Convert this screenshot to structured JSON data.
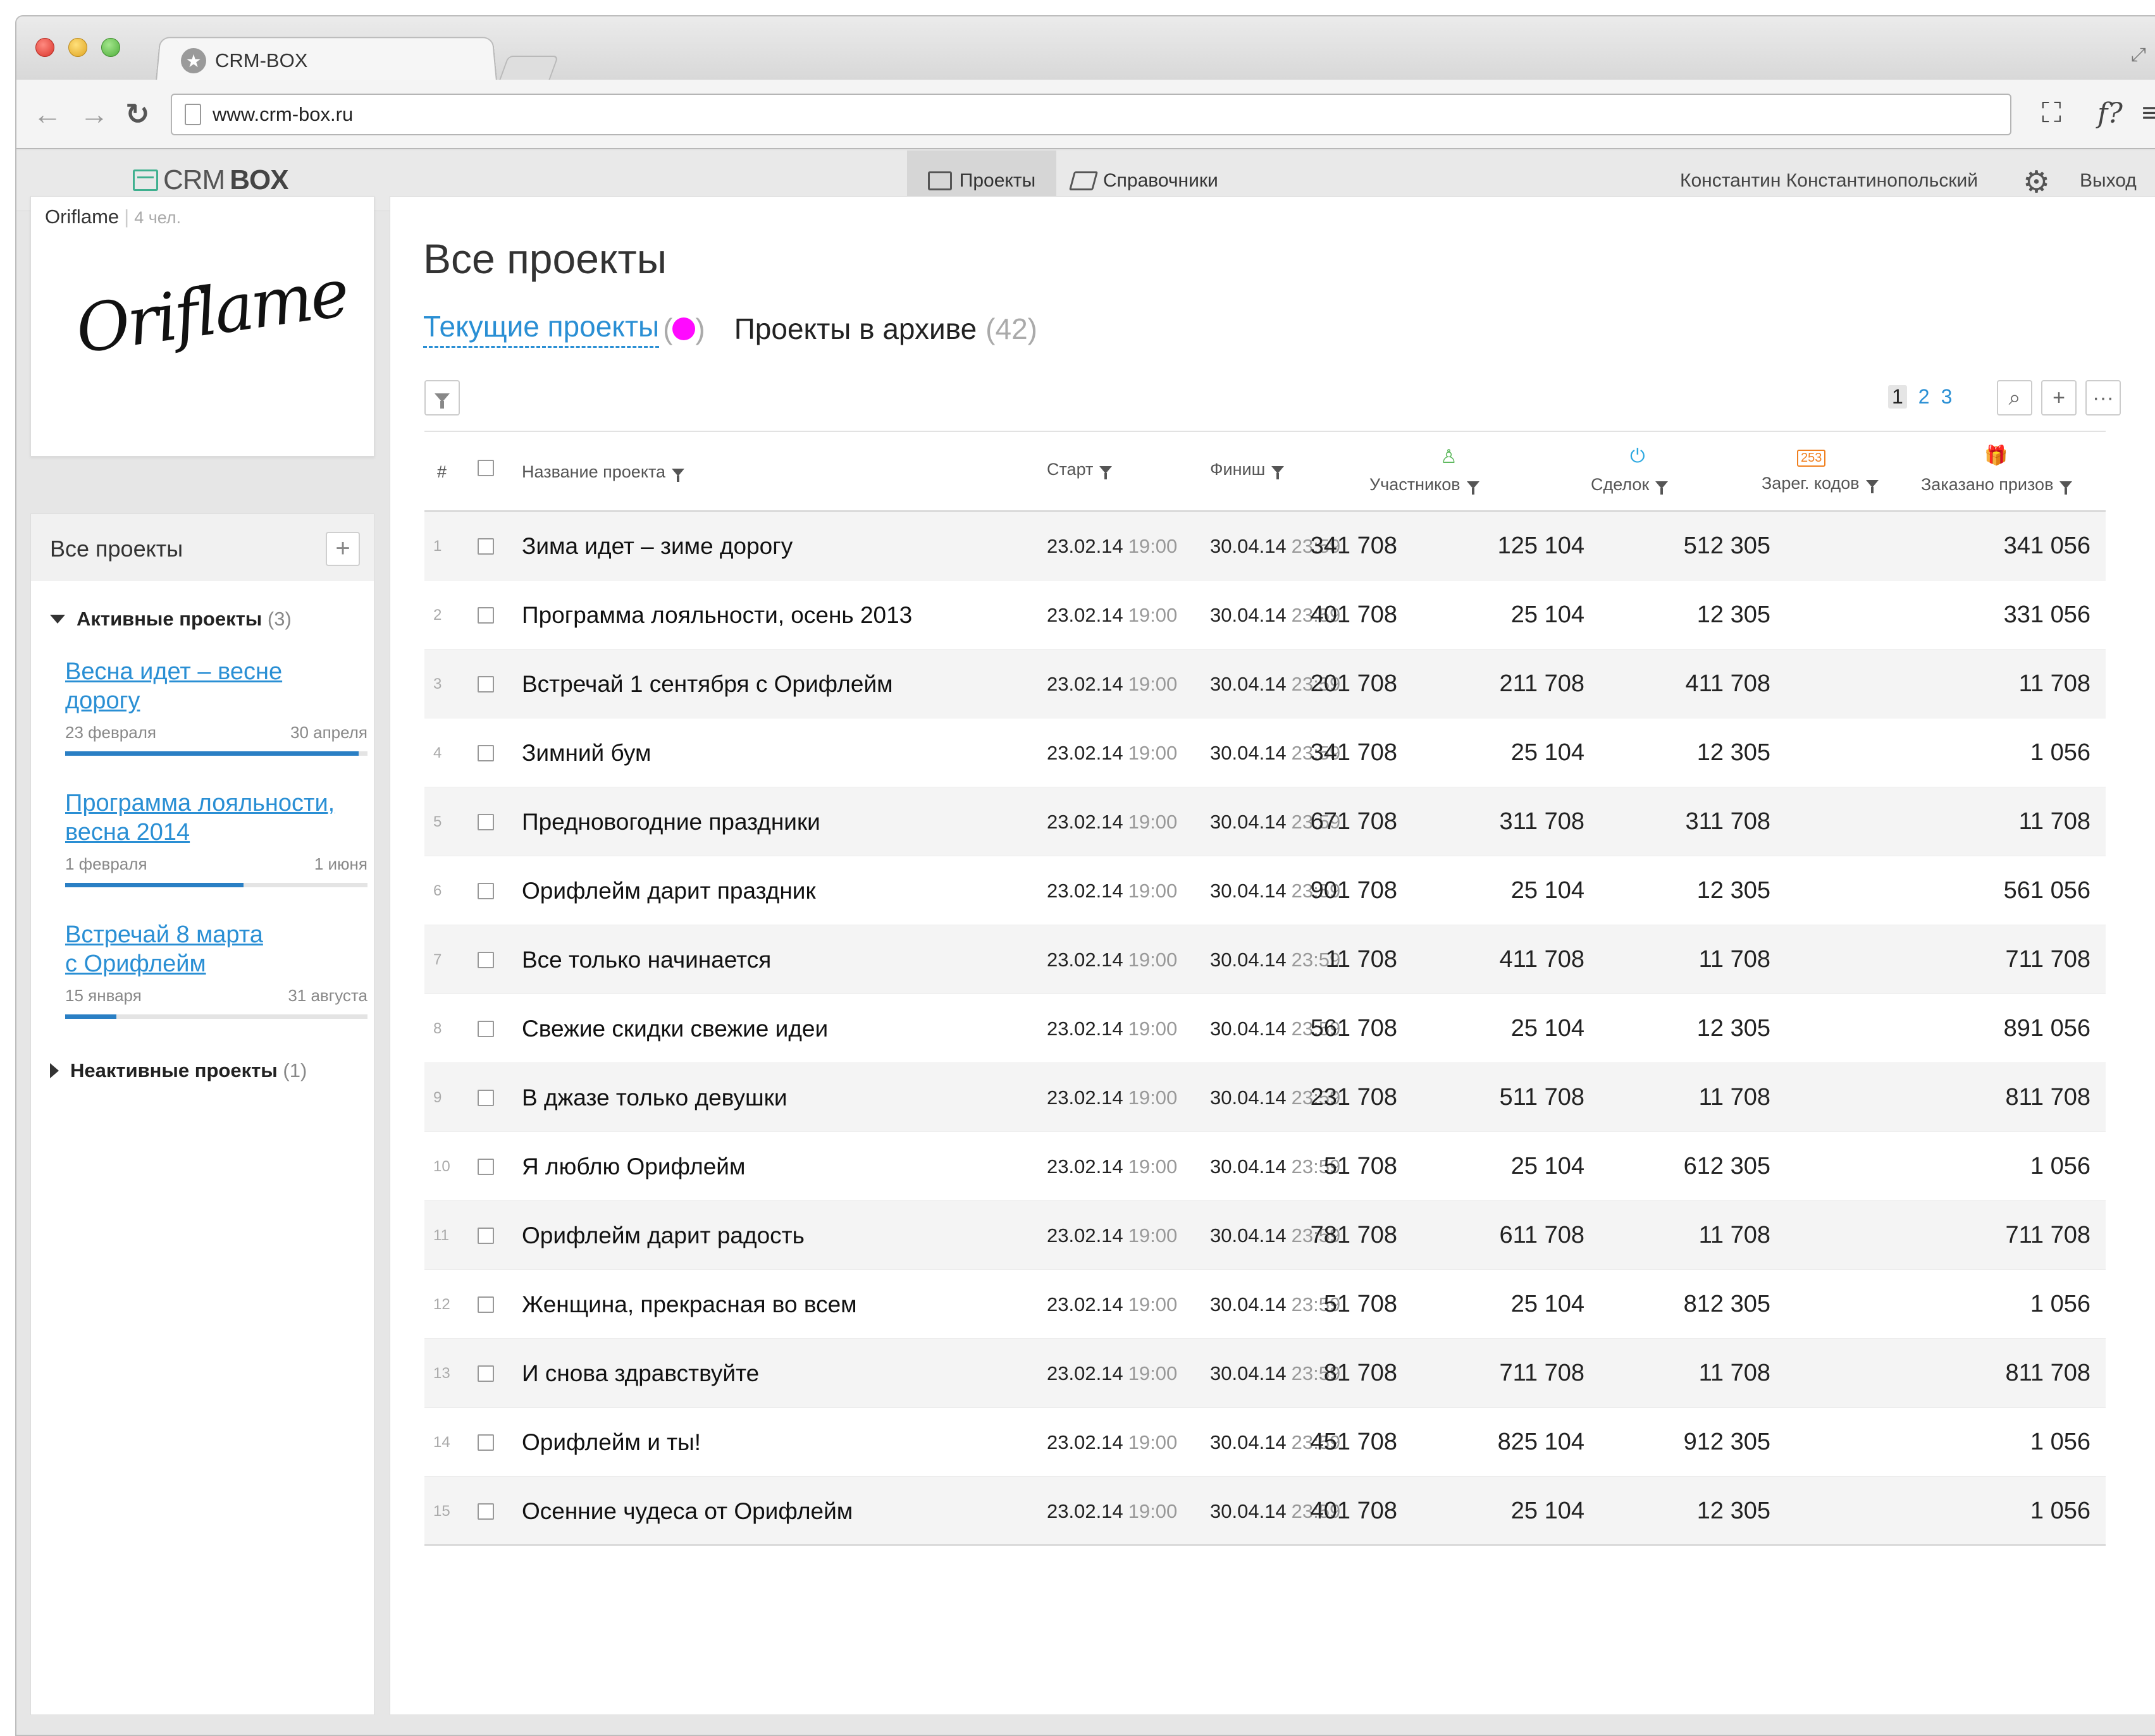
{
  "browser": {
    "tab_title": "CRM-BOX",
    "url": "www.crm-box.ru"
  },
  "app": {
    "logo_crm": "CRM",
    "logo_box": "BOX",
    "nav_projects": "Проекты",
    "nav_references": "Справочники",
    "user_name": "Константин Константинопольский",
    "logout": "Выход"
  },
  "company": {
    "name": "Oriflame",
    "members": "4 чел.",
    "logo_text": "Oriflame"
  },
  "sidebar": {
    "title": "Все проекты",
    "active_label": "Активные  проекты",
    "active_count": "(3)",
    "inactive_label": "Неактивные проекты",
    "inactive_count": "(1)",
    "projects": [
      {
        "title_line1": "Весна идет – весне ",
        "title_line2": "дорогу",
        "start": "23 февраля",
        "end": "30 апреля",
        "progress": 0.97
      },
      {
        "title_line1": "Программа лояльности,",
        "title_line2": "весна 2014",
        "start": "1 февраля",
        "end": "1 июня",
        "progress": 0.59
      },
      {
        "title_line1": "Встречай 8 марта",
        "title_line2": "с Орифлейм",
        "start": "15 января",
        "end": "31 августа",
        "progress": 0.17
      }
    ]
  },
  "main": {
    "title": "Все проекты",
    "tab_current": "Текущие проекты",
    "tab_current_open": "(",
    "tab_current_close": ")",
    "tab_archive": "Проекты в архиве",
    "archive_count": "(42)",
    "pages": [
      "1",
      "2",
      "3"
    ],
    "active_page": "1",
    "columns": {
      "num": "#",
      "name": "Название проекта",
      "start": "Старт",
      "finish": "Финиш",
      "participants": "Участников",
      "deals": "Сделок",
      "codes": "Зарег. кодов",
      "codes_badge": "253",
      "prizes": "Заказано призов"
    },
    "rows": [
      {
        "n": "1",
        "name": "Зима идет – зиме дорогу",
        "start_d": "23.02.14",
        "start_t": "19:00",
        "fin_d": "30.04.14",
        "fin_t": "23:59",
        "participants": "341 708",
        "deals": "125 104",
        "codes": "512 305",
        "prizes": "341 056"
      },
      {
        "n": "2",
        "name": "Программа лояльности, осень 2013",
        "start_d": "23.02.14",
        "start_t": "19:00",
        "fin_d": "30.04.14",
        "fin_t": "23:59",
        "participants": "401 708",
        "deals": "25 104",
        "codes": "12 305",
        "prizes": "331 056"
      },
      {
        "n": "3",
        "name": "Встречай 1 сентября с Орифлейм",
        "start_d": "23.02.14",
        "start_t": "19:00",
        "fin_d": "30.04.14",
        "fin_t": "23:59",
        "participants": "201 708",
        "deals": "211 708",
        "codes": "411 708",
        "prizes": "11 708"
      },
      {
        "n": "4",
        "name": "Зимний бум",
        "start_d": "23.02.14",
        "start_t": "19:00",
        "fin_d": "30.04.14",
        "fin_t": "23:59",
        "participants": "341 708",
        "deals": "25 104",
        "codes": "12 305",
        "prizes": "1 056"
      },
      {
        "n": "5",
        "name": "Предновогодние праздники",
        "start_d": "23.02.14",
        "start_t": "19:00",
        "fin_d": "30.04.14",
        "fin_t": "23:59",
        "participants": "671 708",
        "deals": "311 708",
        "codes": "311 708",
        "prizes": "11 708"
      },
      {
        "n": "6",
        "name": "Орифлейм дарит праздник",
        "start_d": "23.02.14",
        "start_t": "19:00",
        "fin_d": "30.04.14",
        "fin_t": "23:59",
        "participants": "901 708",
        "deals": "25 104",
        "codes": "12 305",
        "prizes": "561 056"
      },
      {
        "n": "7",
        "name": "Все только начинается",
        "start_d": "23.02.14",
        "start_t": "19:00",
        "fin_d": "30.04.14",
        "fin_t": "23:59",
        "participants": "11 708",
        "deals": "411 708",
        "codes": "11 708",
        "prizes": "711 708"
      },
      {
        "n": "8",
        "name": "Свежие скидки свежие идеи",
        "start_d": "23.02.14",
        "start_t": "19:00",
        "fin_d": "30.04.14",
        "fin_t": "23:59",
        "participants": "561 708",
        "deals": "25 104",
        "codes": "12 305",
        "prizes": "891 056"
      },
      {
        "n": "9",
        "name": "В джазе только девушки",
        "start_d": "23.02.14",
        "start_t": "19:00",
        "fin_d": "30.04.14",
        "fin_t": "23:59",
        "participants": "231 708",
        "deals": "511 708",
        "codes": "11 708",
        "prizes": "811 708"
      },
      {
        "n": "10",
        "name": "Я люблю Орифлейм",
        "start_d": "23.02.14",
        "start_t": "19:00",
        "fin_d": "30.04.14",
        "fin_t": "23:59",
        "participants": "51 708",
        "deals": "25 104",
        "codes": "612 305",
        "prizes": "1 056"
      },
      {
        "n": "11",
        "name": "Орифлейм дарит радость",
        "start_d": "23.02.14",
        "start_t": "19:00",
        "fin_d": "30.04.14",
        "fin_t": "23:59",
        "participants": "781 708",
        "deals": "611 708",
        "codes": "11 708",
        "prizes": "711 708"
      },
      {
        "n": "12",
        "name": "Женщина, прекрасная во всем",
        "start_d": "23.02.14",
        "start_t": "19:00",
        "fin_d": "30.04.14",
        "fin_t": "23:59",
        "participants": "51 708",
        "deals": "25 104",
        "codes": "812 305",
        "prizes": "1 056"
      },
      {
        "n": "13",
        "name": "И снова здравствуйте",
        "start_d": "23.02.14",
        "start_t": "19:00",
        "fin_d": "30.04.14",
        "fin_t": "23:59",
        "participants": "81 708",
        "deals": "711 708",
        "codes": "11 708",
        "prizes": "811 708"
      },
      {
        "n": "14",
        "name": "Орифлейм и ты!",
        "start_d": "23.02.14",
        "start_t": "19:00",
        "fin_d": "30.04.14",
        "fin_t": "23:59",
        "participants": "451 708",
        "deals": "825 104",
        "codes": "912 305",
        "prizes": "1 056"
      },
      {
        "n": "15",
        "name": "Осенние чудеса от Орифлейм",
        "start_d": "23.02.14",
        "start_t": "19:00",
        "fin_d": "30.04.14",
        "fin_t": "23:59",
        "participants": "401 708",
        "deals": "25 104",
        "codes": "12 305",
        "prizes": "1 056"
      }
    ]
  },
  "colors": {
    "accent": "#2a8fd4",
    "status_dot": "#ff0aff",
    "progress": "#2a7fc4",
    "participants_icon": "#5cb85c",
    "deals_icon": "#2aa8e0",
    "codes_badge": "#f07f1e",
    "prizes_icon": "#e0403c"
  },
  "icons": {
    "tab": "star-icon",
    "back": "arrow-left-icon",
    "forward": "arrow-right-icon",
    "reload": "reload-icon",
    "page": "page-icon",
    "projects": "box-icon",
    "references": "book-icon",
    "settings": "gear-icon",
    "filter": "funnel-icon",
    "search": "search-icon",
    "add": "plus-icon",
    "more": "ellipsis-icon",
    "participants": "user-icon",
    "deals": "deal-icon",
    "prizes": "gift-icon"
  }
}
